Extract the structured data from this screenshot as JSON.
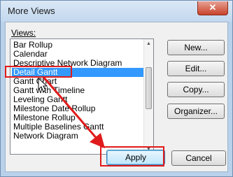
{
  "window": {
    "title": "More Views",
    "close_glyph": "✕"
  },
  "views": {
    "label": "Views:",
    "items": [
      "Bar Rollup",
      "Calendar",
      "Descriptive Network Diagram",
      "Detail Gantt",
      "Gantt Chart",
      "Gantt with Timeline",
      "Leveling Gantt",
      "Milestone Date Rollup",
      "Milestone Rollup",
      "Multiple Baselines Gantt",
      "Network Diagram"
    ],
    "selected_index": 3
  },
  "buttons": {
    "new": "New...",
    "edit": "Edit...",
    "copy": "Copy...",
    "organizer": "Organizer...",
    "apply": "Apply",
    "cancel": "Cancel"
  },
  "annotation": {
    "color": "#e01b1b"
  }
}
